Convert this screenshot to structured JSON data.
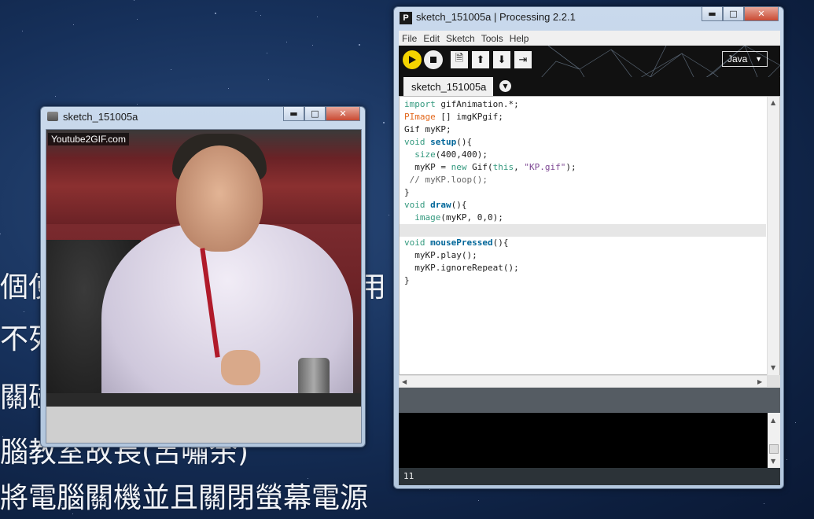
{
  "desktop": {
    "bg_lines": [
      "個使",
      "用",
      "不列",
      "關碰",
      "腦教室故長(呂嘯余)",
      "將電腦關機並且關閉螢幕電源"
    ]
  },
  "sketch_window": {
    "title": "sketch_151005a",
    "watermark": "Youtube2GIF.com"
  },
  "processing_window": {
    "title": "sketch_151005a | Processing 2.2.1",
    "menu": [
      "File",
      "Edit",
      "Sketch",
      "Tools",
      "Help"
    ],
    "mode": "Java",
    "tab": "sketch_151005a",
    "line_number": "11",
    "code": [
      "import gifAnimation.*;",
      "PImage [] imgKPgif;",
      "Gif myKP;",
      "void setup(){",
      "  size(400,400);",
      "  myKP = new Gif(this, \"KP.gif\");",
      " // myKP.loop();",
      "}",
      "void draw(){",
      "  image(myKP, 0,0);",
      "}",
      "void mousePressed(){",
      "  myKP.play();",
      "  myKP.ignoreRepeat();",
      "}"
    ]
  },
  "icons": {
    "run": "run-icon",
    "stop": "stop-icon",
    "new": "new-file-icon",
    "open": "open-icon",
    "save": "save-icon",
    "export": "export-icon"
  },
  "colors": {
    "run_button": "#f4d400",
    "keyword": "#33997e",
    "type": "#e2661a",
    "function": "#006699",
    "string": "#7d4793"
  }
}
